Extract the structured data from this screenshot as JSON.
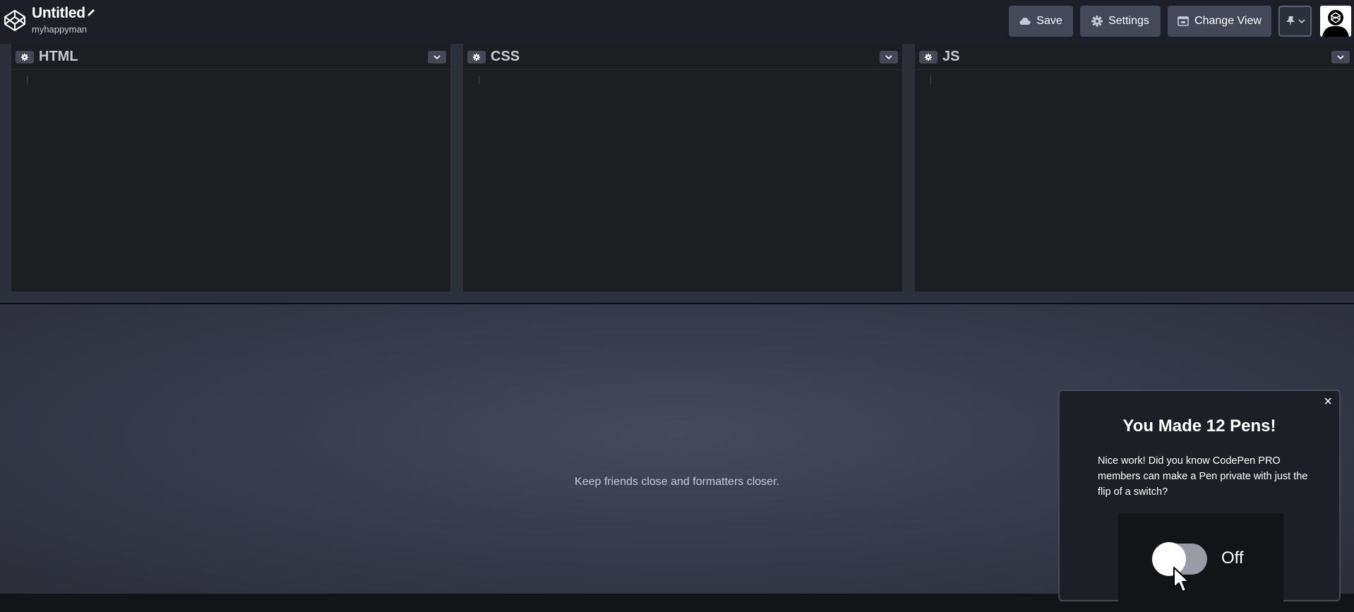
{
  "header": {
    "title": "Untitled",
    "author": "myhappyman",
    "buttons": {
      "save": "Save",
      "settings": "Settings",
      "change_view": "Change View"
    }
  },
  "editors": [
    {
      "name": "html",
      "title": "HTML"
    },
    {
      "name": "css",
      "title": "CSS"
    },
    {
      "name": "js",
      "title": "JS"
    }
  ],
  "preview": {
    "message": "Keep friends close and formatters closer."
  },
  "popup": {
    "title": "You Made 12 Pens!",
    "text": "Nice work! Did you know CodePen PRO members can make a Pen private with just the flip of a switch?",
    "toggle_label": "Off",
    "close": "×"
  },
  "colors": {
    "header_bg": "#1e1f26",
    "button_bg": "#444857",
    "editor_bg": "#1d1e22",
    "text_muted": "#c7c9d3"
  }
}
